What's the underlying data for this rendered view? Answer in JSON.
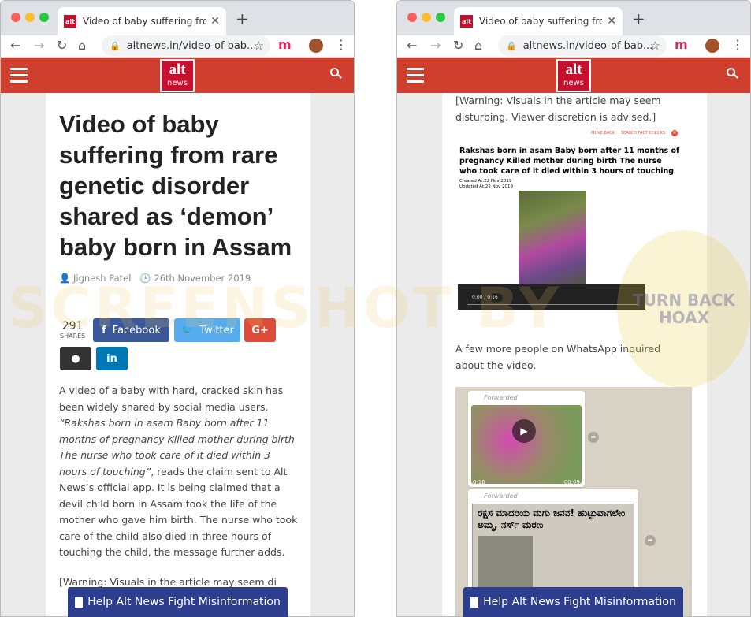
{
  "browser": {
    "tab_title": "Video of baby suffering from rare",
    "favicon": "alt",
    "url": "altnews.in/video-of-bab...",
    "ext_letter": "m"
  },
  "site": {
    "logo_top": "alt",
    "logo_bottom": "news"
  },
  "article": {
    "title": "Video of baby suffering from rare genetic disorder shared as ‘demon’ baby born in Assam",
    "author": "Jignesh Patel",
    "date": "26th November 2019",
    "share_count": "291",
    "shares_label": "SHARES",
    "share_buttons": {
      "facebook": "Facebook",
      "twitter": "Twitter",
      "gplus": "G+",
      "reddit": "reddit",
      "linkedin": "in"
    },
    "p1_a": "A video of a baby with hard, cracked skin has been widely shared by social media users.",
    "p1_quote": "“Rakshas born in asam Baby born after 11 months of pregnancy Killed mother during birth The nurse who took care of it died within 3 hours of touching”",
    "p1_b": ", reads the claim sent to Alt News’s official app. It is being claimed that a devil child born in Assam took the life of the mother who gave him birth. The nurse who took care of the child also died in three hours of touching the child, the message further adds.",
    "warning": "[Warning: Visuals in the article may seem disturbing. Viewer discretion is advised.]",
    "warning_cut": "[Warning: Visuals in the article may seem di",
    "p2": "A few more people on WhatsApp inquired about the video."
  },
  "embedded_shot": {
    "icon_labels": [
      "MOVE BACK",
      "SEARCH FACT CHECKS"
    ],
    "title": "Rakshas born in asam Baby born after 11 months of pregnancy Killed mother during birth The nurse who took care of it died within 3 hours of touching",
    "created": "Created At:22 Nov 2019",
    "updated": "Updated At:25 Nov 2019",
    "video_time": "0:00 / 0:16"
  },
  "whatsapp": {
    "forwarded": "Forwarded",
    "dur_left": "0:16",
    "dur_right": "00:09",
    "headline": "ರಕ್ಷಸ ಮಾದರಿಯ ಮಗು ಜನನ! ಹುಟ್ಟುವಾಗಲೇಂ ಅಮ್ಮ, ನರ್ಸ್ ಮರಣ"
  },
  "cta": "Help Alt News Fight Misinformation",
  "watermark": "SCREENSHOT BY",
  "stamp_text": "TURN BACK HOAX",
  "colors": {
    "header": "#d03f2d",
    "cta": "#2d3e8f",
    "facebook": "#3b5998",
    "twitter": "#55acee"
  }
}
